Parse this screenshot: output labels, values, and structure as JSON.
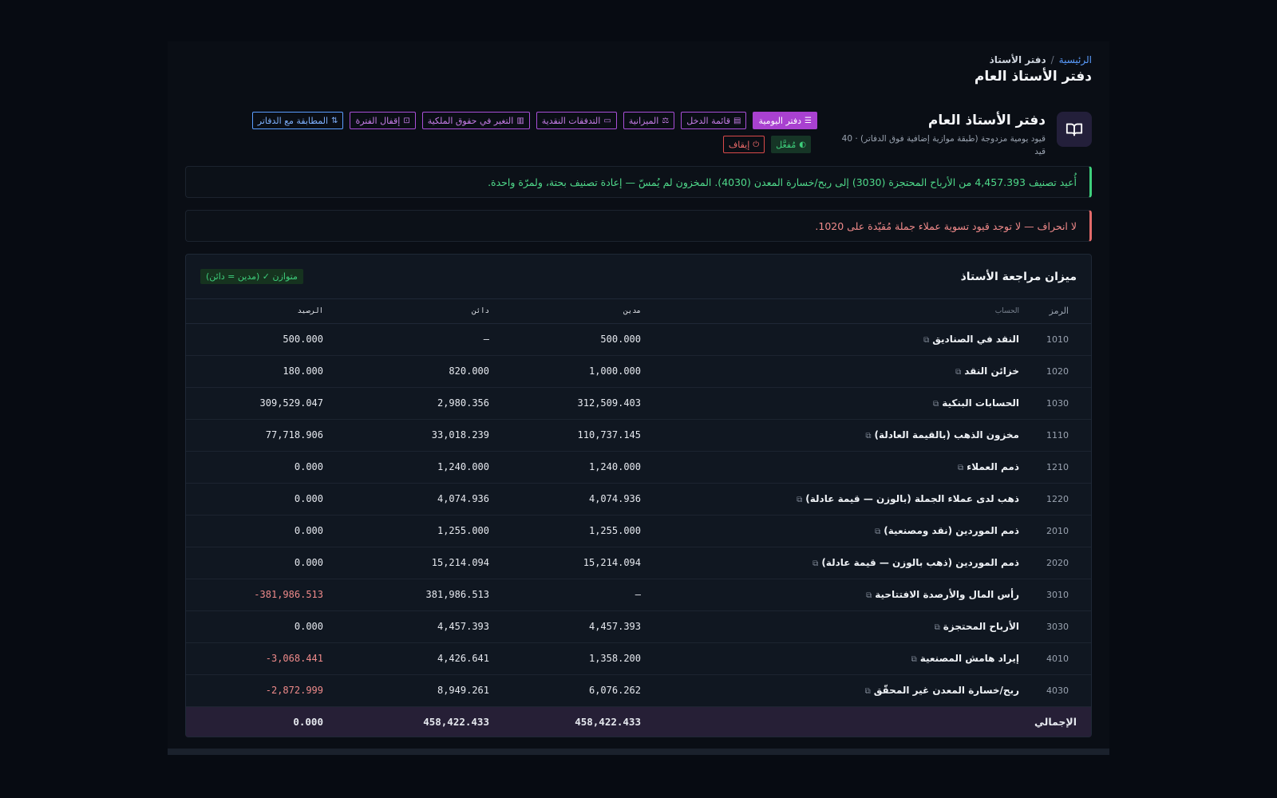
{
  "breadcrumb": {
    "home": "الرئيسية",
    "separator": "/",
    "current": "دفتر الأستاذ"
  },
  "page_title": "دفتر الأستاذ العام",
  "hero": {
    "icon": "book-open-icon",
    "title": "دفتر الأستاذ العام",
    "subtitle": "قيود يومية مزدوجة (طبقة موازية إضافية فوق الدفاتر) · 40 قيد"
  },
  "toolbar": {
    "journal": "دفتر اليومية",
    "income": "قائمة الدخل",
    "budget": "الميزانية",
    "cashflow": "التدفقات النقدية",
    "equity": "التغير في حقوق الملكية",
    "close_period": "إقفال الفترة",
    "reconcile": "المطابقة مع الدفاتر",
    "enabled": "مُفعَّل",
    "stop": "إيقاف"
  },
  "alerts": {
    "success": "أُعيد تصنيف 4,457.393 من الأرباح المحتجزة (3030) إلى ربح/خسارة المعدن (4030). المخزون لم يُمسّ — إعادة تصنيف بحتة، ولمرّة واحدة.",
    "warning": "لا انحراف — لا توجد قيود تسوية عملاء جملة مُقيّدة على 1020."
  },
  "trial": {
    "title": "ميزان مراجعة الأستاذ",
    "badge": "متوازن ✓ (مدين = دائن)",
    "headers": {
      "code": "الرمز",
      "account": "الحساب",
      "debit": "مدين",
      "credit": "دائن",
      "balance": "الرصيد"
    },
    "rows": [
      {
        "code": "1010",
        "name": "النقد في الصناديق",
        "debit": "500.000",
        "credit": "—",
        "balance": "500.000"
      },
      {
        "code": "1020",
        "name": "خزائن النقد",
        "debit": "1,000.000",
        "credit": "820.000",
        "balance": "180.000"
      },
      {
        "code": "1030",
        "name": "الحسابات البنكية",
        "debit": "312,509.403",
        "credit": "2,980.356",
        "balance": "309,529.047"
      },
      {
        "code": "1110",
        "name": "مخزون الذهب (بالقيمة العادلة)",
        "debit": "110,737.145",
        "credit": "33,018.239",
        "balance": "77,718.906"
      },
      {
        "code": "1210",
        "name": "ذمم العملاء",
        "debit": "1,240.000",
        "credit": "1,240.000",
        "balance": "0.000"
      },
      {
        "code": "1220",
        "name": "ذهب لدى عملاء الجملة (بالوزن — قيمة عادلة)",
        "debit": "4,074.936",
        "credit": "4,074.936",
        "balance": "0.000"
      },
      {
        "code": "2010",
        "name": "ذمم الموردين (نقد ومصنعية)",
        "debit": "1,255.000",
        "credit": "1,255.000",
        "balance": "0.000"
      },
      {
        "code": "2020",
        "name": "ذمم الموردين (ذهب بالوزن — قيمة عادلة)",
        "debit": "15,214.094",
        "credit": "15,214.094",
        "balance": "0.000"
      },
      {
        "code": "3010",
        "name": "رأس المال والأرصدة الافتتاحية",
        "debit": "—",
        "credit": "381,986.513",
        "balance": "381,986.513-"
      },
      {
        "code": "3030",
        "name": "الأرباح المحتجزة",
        "debit": "4,457.393",
        "credit": "4,457.393",
        "balance": "0.000"
      },
      {
        "code": "4010",
        "name": "إيراد هامش المصنعية",
        "debit": "1,358.200",
        "credit": "4,426.641",
        "balance": "3,068.441-"
      },
      {
        "code": "4030",
        "name": "ربح/خسارة المعدن غير المحقّق",
        "debit": "6,076.262",
        "credit": "8,949.261",
        "balance": "2,872.999-"
      }
    ],
    "total": {
      "label": "الإجمالي",
      "debit": "458,422.433",
      "credit": "458,422.433",
      "balance": "0.000"
    }
  },
  "colors": {
    "accent": "#a941d0",
    "success": "#3ecf7c",
    "danger": "#e36a6a",
    "link": "#5b9dff"
  }
}
